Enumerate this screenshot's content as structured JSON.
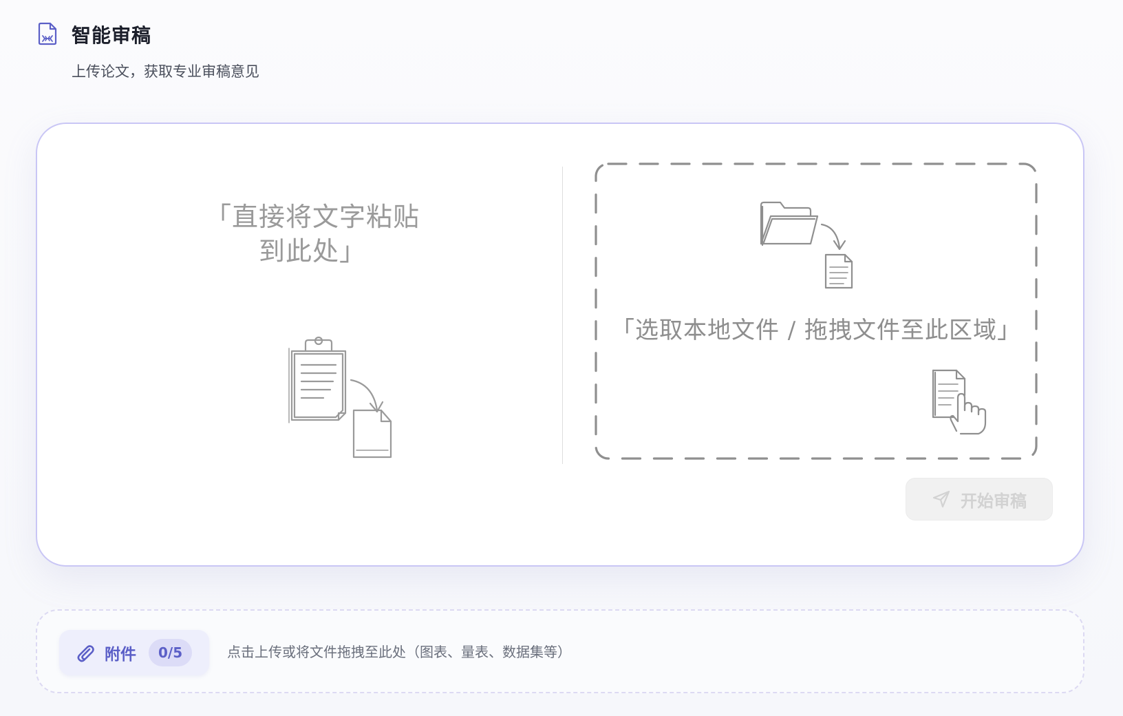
{
  "header": {
    "title": "智能审稿",
    "subtitle": "上传论文，获取专业审稿意见",
    "icon": "document-icon"
  },
  "editor": {
    "paste_prompt_line1": "「直接将文字粘贴",
    "paste_prompt_line2": "到此处」",
    "upload_prompt": "「选取本地文件 / 拖拽文件至此区域」",
    "start_button_label": "开始审稿",
    "start_button_icon": "send-icon"
  },
  "attachments": {
    "button_label": "附件",
    "count": "0/5",
    "hint": "点击上传或将文件拖拽至此处（图表、量表、数据集等）",
    "icon": "paperclip-icon"
  },
  "colors": {
    "accent": "#5b5fc7",
    "card_border": "#c9c6f5",
    "sketch_gray": "#9a9a9a"
  }
}
